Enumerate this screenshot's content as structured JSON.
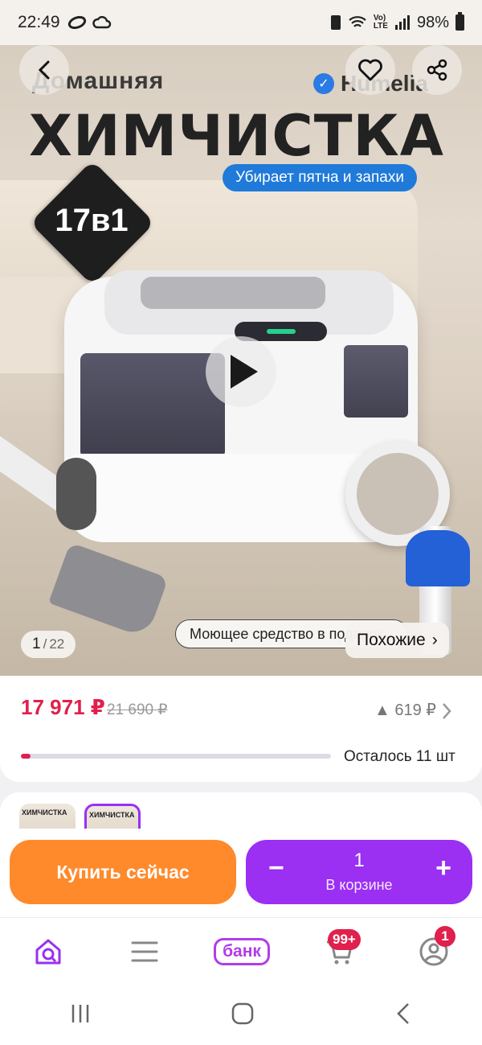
{
  "status_bar": {
    "time": "22:49",
    "battery": "98%"
  },
  "hero": {
    "title_small": "Домашняя",
    "title_large": "ХИМЧИСТКА",
    "brand": "Humelia",
    "tagline": "Убирает пятна и запахи",
    "badge": "17в1",
    "caption": "Моющее средство в подарок",
    "counter_current": "1",
    "counter_total": "22",
    "similar_label": "Похожие",
    "similar_chevron": "›"
  },
  "price": {
    "current": "17 971 ₽",
    "old": "21 690 ₽",
    "diff": "▲ 619 ₽",
    "stock_text": "Осталось 11 шт",
    "stock_fraction": 0.03
  },
  "variants": [
    {
      "label": "ХИМЧИСТКА",
      "selected": false
    },
    {
      "label": "ХИМЧИСТКА",
      "selected": true
    }
  ],
  "actions": {
    "buy_now": "Купить сейчас",
    "cart_qty": "1",
    "cart_label": "В корзине",
    "minus": "−",
    "plus": "+"
  },
  "bottom_nav": {
    "bank_label": "банк",
    "cart_badge": "99+",
    "profile_badge": "1"
  },
  "colors": {
    "price_red": "#e0204d",
    "buy_orange": "#ff8a2b",
    "cart_purple": "#9b2ff2",
    "brand_blue": "#1f7ad9"
  }
}
